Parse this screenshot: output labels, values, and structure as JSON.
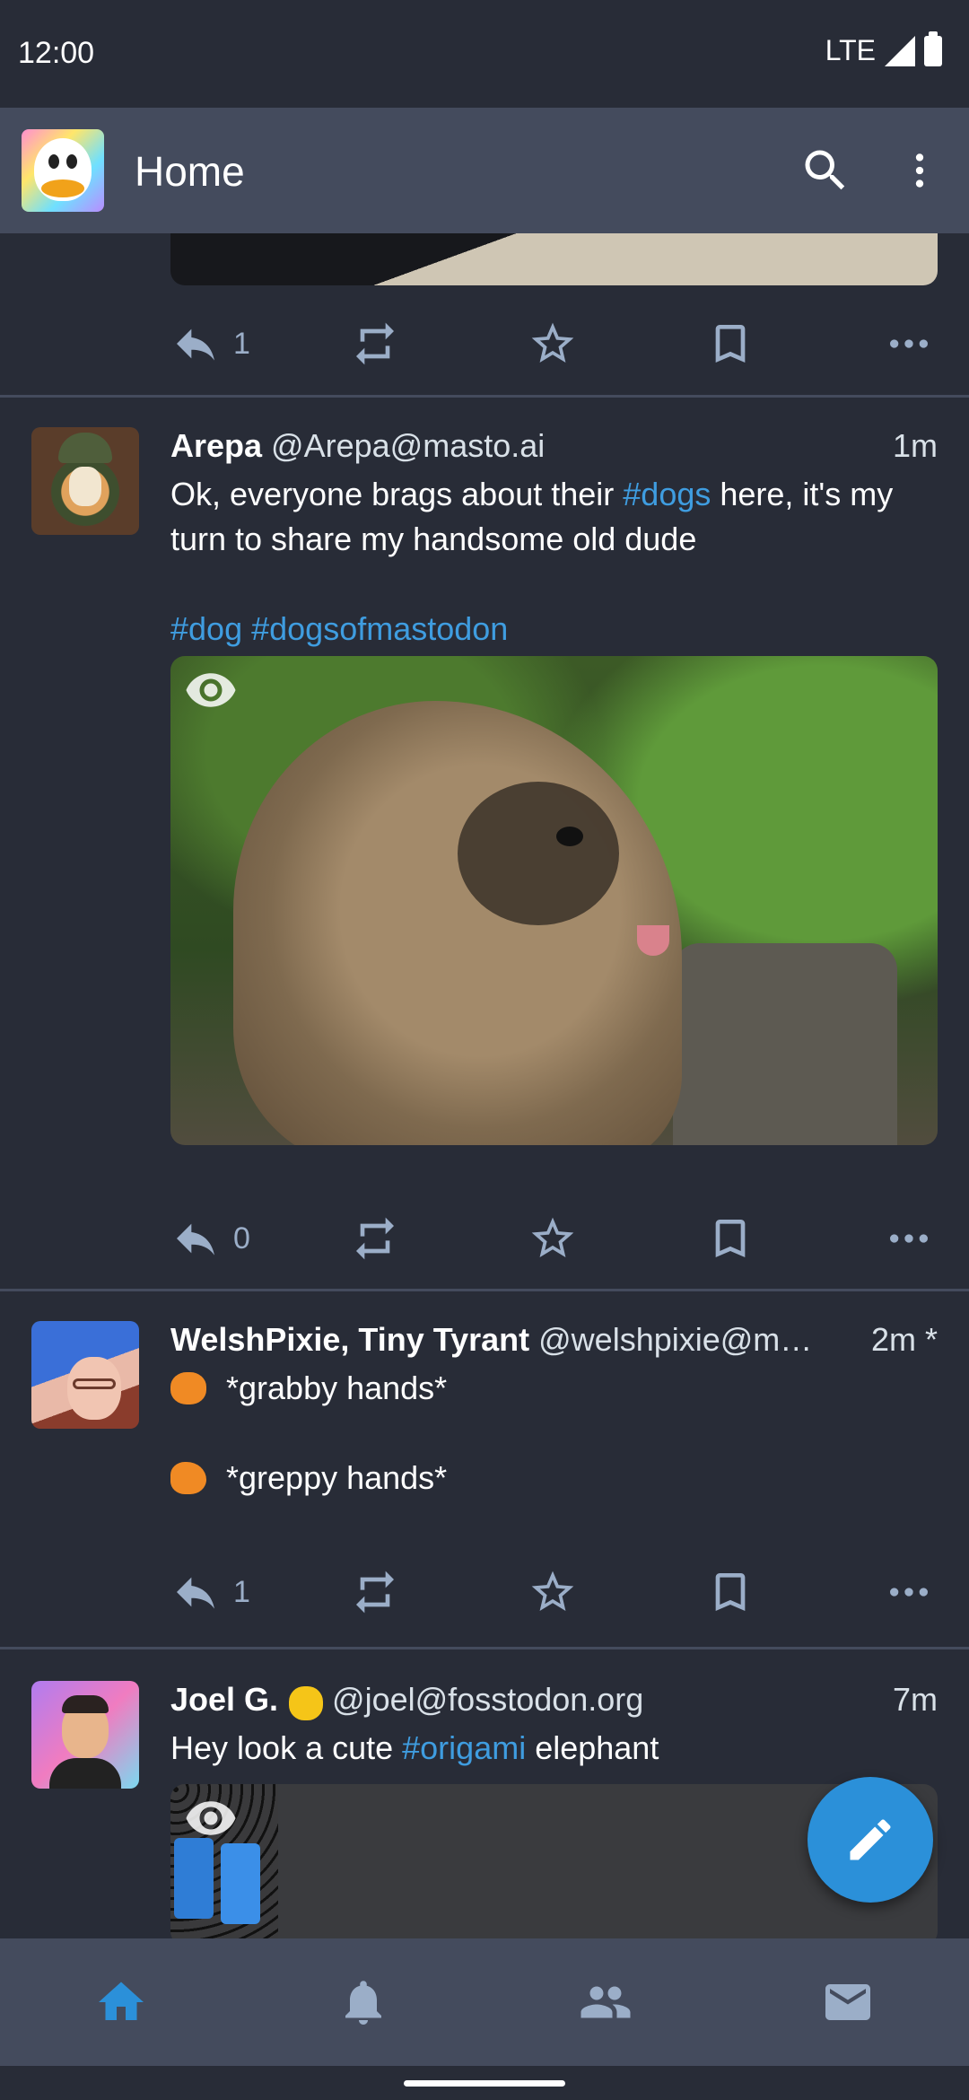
{
  "status_bar": {
    "time": "12:00",
    "network": "LTE"
  },
  "app_bar": {
    "title": "Home",
    "search_icon": "search-icon",
    "menu_icon": "more-vert-icon"
  },
  "prev_post": {
    "reply_count": "1"
  },
  "posts": [
    {
      "display_name": "Arepa",
      "acct": "@Arepa@masto.ai",
      "time": "1m",
      "text_before": "Ok, everyone brags about their ",
      "tag1": "#dogs",
      "text_after": " here, it's my turn to share my handsome old dude",
      "tags_line": [
        "#dog",
        "#dogsofmastodon"
      ],
      "reply_count": "0"
    },
    {
      "display_name": "WelshPixie, Tiny Tyrant",
      "acct": "@welshpixie@m…",
      "time": "2m *",
      "line1": "*grabby hands*",
      "line2": "*greppy hands*",
      "reply_count": "1"
    },
    {
      "display_name": "Joel G.",
      "acct": "@joel@fosstodon.org",
      "time": "7m",
      "text_before": "Hey look a cute ",
      "tag1": "#origami",
      "text_after": " elephant"
    }
  ],
  "action_icons": [
    "reply-icon",
    "boost-icon",
    "favourite-icon",
    "bookmark-icon",
    "more-horiz-icon"
  ],
  "fab": {
    "icon": "pencil-icon"
  },
  "bottom_nav": [
    {
      "name": "home",
      "icon": "home-icon",
      "active": true
    },
    {
      "name": "notifications",
      "icon": "bell-icon",
      "active": false
    },
    {
      "name": "lists",
      "icon": "people-icon",
      "active": false
    },
    {
      "name": "direct-messages",
      "icon": "mail-icon",
      "active": false
    }
  ],
  "colors": {
    "background": "#282c37",
    "bar": "#444b5d",
    "accent": "#2b90d9",
    "hashtag": "#3f9de0",
    "muted": "#9baec8"
  }
}
